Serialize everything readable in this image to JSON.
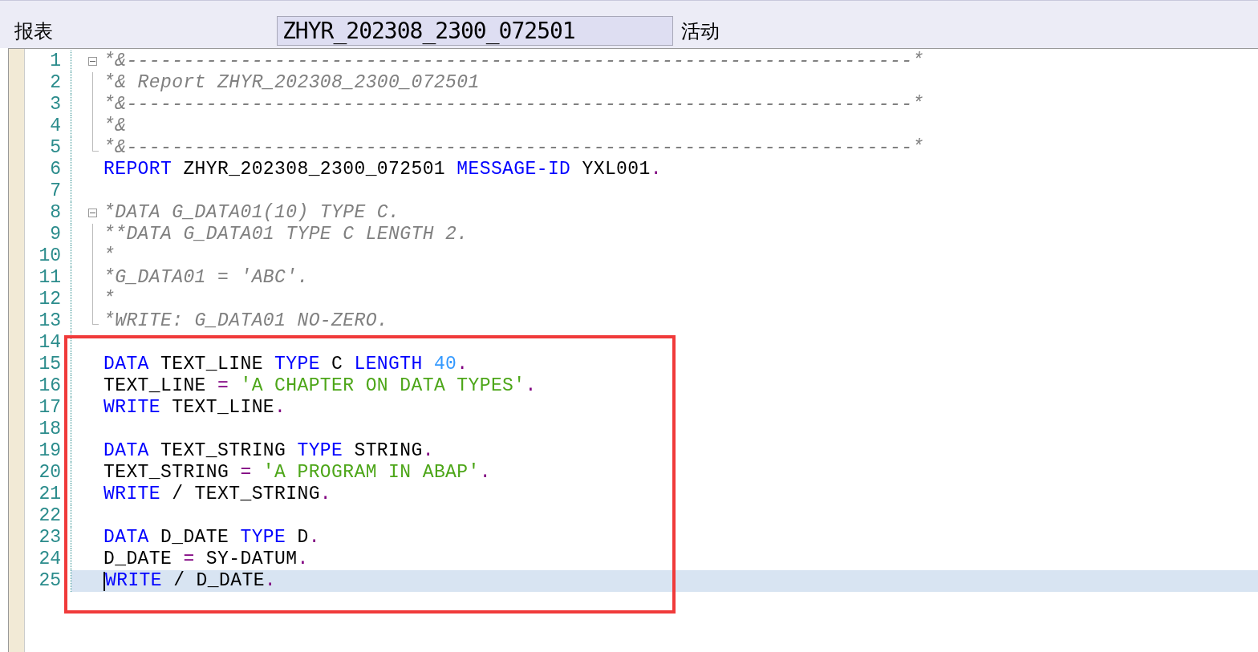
{
  "header": {
    "label": "报表",
    "program": "ZHYR_202308_2300_072501",
    "status": "活动"
  },
  "lines": [
    {
      "number": "1",
      "expanded": true,
      "current": false,
      "tokens": [
        {
          "kind": "comment",
          "text": "*&---------------------------------------------------------------------*"
        }
      ],
      "children": [
        {
          "number": "2",
          "current": false,
          "tokens": [
            {
              "kind": "comment",
              "text": "*& Report ZHYR_202308_2300_072501"
            }
          ]
        },
        {
          "number": "3",
          "current": false,
          "tokens": [
            {
              "kind": "comment",
              "text": "*&---------------------------------------------------------------------*"
            }
          ]
        },
        {
          "number": "4",
          "current": false,
          "tokens": [
            {
              "kind": "comment",
              "text": "*&"
            }
          ]
        },
        {
          "number": "5",
          "current": false,
          "tokens": [
            {
              "kind": "comment",
              "text": "*&---------------------------------------------------------------------*"
            }
          ]
        }
      ]
    },
    {
      "number": "6",
      "current": false,
      "tokens": [
        {
          "kind": "keyword",
          "text": "REPORT"
        },
        {
          "kind": "plain",
          "text": " ZHYR_202308_2300_072501 "
        },
        {
          "kind": "keyword",
          "text": "MESSAGE-ID"
        },
        {
          "kind": "plain",
          "text": " YXL001"
        },
        {
          "kind": "punct",
          "text": "."
        }
      ]
    },
    {
      "number": "7",
      "current": false
    },
    {
      "number": "8",
      "expanded": true,
      "current": false,
      "tokens": [
        {
          "kind": "comment",
          "text": "*DATA G_DATA01(10) TYPE C."
        }
      ],
      "children": [
        {
          "number": "9",
          "current": false,
          "tokens": [
            {
              "kind": "comment",
              "text": "**DATA G_DATA01 TYPE C LENGTH 2."
            }
          ]
        },
        {
          "number": "10",
          "current": false,
          "tokens": [
            {
              "kind": "comment",
              "text": "*"
            }
          ]
        },
        {
          "number": "11",
          "current": false,
          "tokens": [
            {
              "kind": "comment",
              "text": "*G_DATA01 = 'ABC'."
            }
          ]
        },
        {
          "number": "12",
          "current": false,
          "tokens": [
            {
              "kind": "comment",
              "text": "*"
            }
          ]
        },
        {
          "number": "13",
          "current": false,
          "tokens": [
            {
              "kind": "comment",
              "text": "*WRITE: G_DATA01 NO-ZERO."
            }
          ]
        }
      ]
    },
    {
      "number": "14",
      "current": false
    },
    {
      "number": "15",
      "current": false,
      "tokens": [
        {
          "kind": "keyword",
          "text": "DATA"
        },
        {
          "kind": "plain",
          "text": " TEXT_LINE "
        },
        {
          "kind": "keyword",
          "text": "TYPE"
        },
        {
          "kind": "plain",
          "text": " C "
        },
        {
          "kind": "keyword",
          "text": "LENGTH "
        },
        {
          "kind": "number",
          "text": "40"
        },
        {
          "kind": "punct",
          "text": "."
        }
      ]
    },
    {
      "number": "16",
      "current": false,
      "tokens": [
        {
          "kind": "plain",
          "text": "TEXT_LINE "
        },
        {
          "kind": "punct",
          "text": "= "
        },
        {
          "kind": "string",
          "text": "'A CHAPTER ON DATA TYPES'"
        },
        {
          "kind": "punct",
          "text": "."
        }
      ]
    },
    {
      "number": "17",
      "current": false,
      "tokens": [
        {
          "kind": "keyword",
          "text": "WRITE"
        },
        {
          "kind": "plain",
          "text": " TEXT_LINE"
        },
        {
          "kind": "punct",
          "text": "."
        }
      ]
    },
    {
      "number": "18",
      "current": false
    },
    {
      "number": "19",
      "current": false,
      "tokens": [
        {
          "kind": "keyword",
          "text": "DATA"
        },
        {
          "kind": "plain",
          "text": " TEXT_STRING "
        },
        {
          "kind": "keyword",
          "text": "TYPE"
        },
        {
          "kind": "plain",
          "text": " STRING"
        },
        {
          "kind": "punct",
          "text": "."
        }
      ]
    },
    {
      "number": "20",
      "current": false,
      "tokens": [
        {
          "kind": "plain",
          "text": "TEXT_STRING "
        },
        {
          "kind": "punct",
          "text": "= "
        },
        {
          "kind": "string",
          "text": "'A PROGRAM IN ABAP'"
        },
        {
          "kind": "punct",
          "text": "."
        }
      ]
    },
    {
      "number": "21",
      "current": false,
      "tokens": [
        {
          "kind": "keyword",
          "text": "WRITE"
        },
        {
          "kind": "plain",
          "text": " / TEXT_STRING"
        },
        {
          "kind": "punct",
          "text": "."
        }
      ]
    },
    {
      "number": "22",
      "current": false
    },
    {
      "number": "23",
      "current": false,
      "tokens": [
        {
          "kind": "keyword",
          "text": "DATA"
        },
        {
          "kind": "plain",
          "text": " D_DATE "
        },
        {
          "kind": "keyword",
          "text": "TYPE"
        },
        {
          "kind": "plain",
          "text": " D"
        },
        {
          "kind": "punct",
          "text": "."
        }
      ]
    },
    {
      "number": "24",
      "current": false,
      "tokens": [
        {
          "kind": "plain",
          "text": "D_DATE "
        },
        {
          "kind": "punct",
          "text": "="
        },
        {
          "kind": "plain",
          "text": " SY-DATUM"
        },
        {
          "kind": "punct",
          "text": "."
        }
      ]
    },
    {
      "number": "25",
      "current": true,
      "tokens": [
        {
          "kind": "keyword",
          "text": "WRITE"
        },
        {
          "kind": "plain",
          "text": " / D_DATE"
        },
        {
          "kind": "punct",
          "text": "."
        }
      ]
    }
  ]
}
